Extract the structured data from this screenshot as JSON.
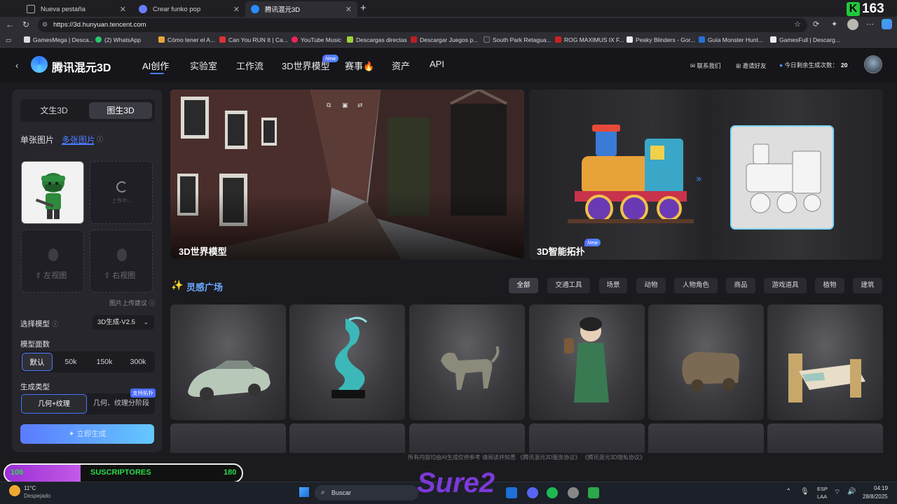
{
  "browser": {
    "tabs": [
      {
        "title": "Nueva pestaña",
        "active": false
      },
      {
        "title": "Crear funko pop",
        "active": false
      },
      {
        "title": "腾讯混元3D",
        "active": true
      }
    ],
    "new_tab": "+",
    "url": "https://3d.hunyuan.tencent.com",
    "bookmarks": [
      "GamesMega | Desca...",
      "(2) WhatsApp",
      "Cómo tener el A...",
      "Can You RUN It | Ca...",
      "YouTube Music",
      "Descargas directas",
      "Descargar Juegos p...",
      "South Park Retagua...",
      "ROG MAXIMUS IX F...",
      "Peaky Blinders - Gor...",
      "Guía Monster Hunt...",
      "GamesFull | Descarg..."
    ],
    "overlay_count": "163"
  },
  "header": {
    "brand": "腾讯混元3D",
    "nav": [
      "AI创作",
      "实验室",
      "工作流",
      "3D世界模型",
      "赛事🔥",
      "资产",
      "API"
    ],
    "new_badge": "New",
    "contact": "联系我们",
    "invite": "邀请好友",
    "quota_label": "今日剩余生成次数：",
    "quota_value": "20"
  },
  "left": {
    "mode_tabs": [
      "文生3D",
      "图生3D"
    ],
    "image_modes": [
      "单张图片",
      "多张图片"
    ],
    "uploading": "上传中...",
    "left_view": "左视图",
    "right_view": "右视图",
    "upload_tip": "图片上传建议",
    "model_label": "选择模型",
    "model_value": "3D生成-V2.5",
    "faces_label": "模型面数",
    "faces": [
      "默认",
      "50k",
      "150k",
      "300k"
    ],
    "gen_type_label": "生成类型",
    "gen_types": [
      "几何+纹理",
      "几何、纹理分阶段"
    ],
    "support_badge": "支持拓扑",
    "generate": "立即生成"
  },
  "banners": {
    "world": "3D世界模型",
    "topo": "3D智能拓扑",
    "topo_badge": "New"
  },
  "gallery": {
    "title": "灵感广场",
    "chips": [
      "全部",
      "交通工具",
      "场景",
      "动物",
      "人物角色",
      "商品",
      "游戏道具",
      "植物",
      "建筑"
    ],
    "footer": "所有内容均由AI生成仅供参考 请阅读并知悉 《腾讯混元3D服务协议》 《腾讯混元3D隐私协议》"
  },
  "stream": {
    "left_num": "106",
    "label": "SUSCRIPTORES",
    "right_num": "180",
    "logo": "Sure2"
  },
  "taskbar": {
    "temp": "11°C",
    "weather": "Despejado",
    "search": "Buscar",
    "lang": "ESP",
    "lang2": "LAA",
    "time": "04:19",
    "date": "28/8/2025"
  },
  "colors": {
    "accent": "#4b7bff",
    "generate_grad_start": "#5b7bff",
    "generate_grad_end": "#64c8ff",
    "stream_bar": "#9b2dd6",
    "stream_text": "#2bd94a"
  }
}
